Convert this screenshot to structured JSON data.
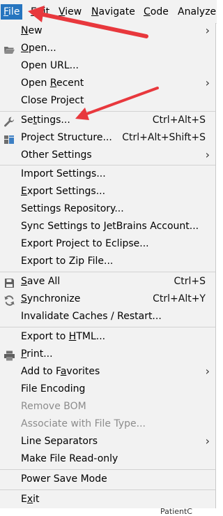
{
  "menubar": {
    "items": [
      {
        "pre": "",
        "mn": "F",
        "post": "ile"
      },
      {
        "pre": "",
        "mn": "E",
        "post": "dit"
      },
      {
        "pre": "",
        "mn": "V",
        "post": "iew"
      },
      {
        "pre": "",
        "mn": "N",
        "post": "avigate"
      },
      {
        "pre": "",
        "mn": "C",
        "post": "ode"
      },
      {
        "pre": "Analyze",
        "mn": "",
        "post": ""
      }
    ]
  },
  "menu": {
    "items": [
      {
        "pre": "",
        "mn": "N",
        "post": "ew",
        "shortcut": ""
      },
      {
        "pre": "",
        "mn": "O",
        "post": "pen...",
        "shortcut": ""
      },
      {
        "pre": "Open URL...",
        "mn": "",
        "post": "",
        "shortcut": ""
      },
      {
        "pre": "Open ",
        "mn": "R",
        "post": "ecent",
        "shortcut": ""
      },
      {
        "pre": "Close Project",
        "mn": "",
        "post": "",
        "shortcut": ""
      },
      {
        "pre": "Se",
        "mn": "t",
        "post": "tings...",
        "shortcut": "Ctrl+Alt+S"
      },
      {
        "pre": "Project Structure...",
        "mn": "",
        "post": "",
        "shortcut": "Ctrl+Alt+Shift+S"
      },
      {
        "pre": "Other Settings",
        "mn": "",
        "post": "",
        "shortcut": ""
      },
      {
        "pre": "Import Settings...",
        "mn": "",
        "post": "",
        "shortcut": ""
      },
      {
        "pre": "",
        "mn": "E",
        "post": "xport Settings...",
        "shortcut": ""
      },
      {
        "pre": "Settings Repository...",
        "mn": "",
        "post": "",
        "shortcut": ""
      },
      {
        "pre": "Sync Settings to JetBrains Account...",
        "mn": "",
        "post": "",
        "shortcut": ""
      },
      {
        "pre": "Export Project to Eclipse...",
        "mn": "",
        "post": "",
        "shortcut": ""
      },
      {
        "pre": "Export to Zip File...",
        "mn": "",
        "post": "",
        "shortcut": ""
      },
      {
        "pre": "",
        "mn": "S",
        "post": "ave All",
        "shortcut": "Ctrl+S"
      },
      {
        "pre": "",
        "mn": "S",
        "post": "ynchronize",
        "shortcut": "Ctrl+Alt+Y"
      },
      {
        "pre": "Invalidate Caches / Restart...",
        "mn": "",
        "post": "",
        "shortcut": ""
      },
      {
        "pre": "Export to ",
        "mn": "H",
        "post": "TML...",
        "shortcut": ""
      },
      {
        "pre": "",
        "mn": "P",
        "post": "rint...",
        "shortcut": ""
      },
      {
        "pre": "Add to F",
        "mn": "a",
        "post": "vorites",
        "shortcut": ""
      },
      {
        "pre": "File Encoding",
        "mn": "",
        "post": "",
        "shortcut": ""
      },
      {
        "pre": "Remove BOM",
        "mn": "",
        "post": "",
        "shortcut": ""
      },
      {
        "pre": "Associate with File Type...",
        "mn": "",
        "post": "",
        "shortcut": ""
      },
      {
        "pre": "Line Separators",
        "mn": "",
        "post": "",
        "shortcut": ""
      },
      {
        "pre": "Make File Read-only",
        "mn": "",
        "post": "",
        "shortcut": ""
      },
      {
        "pre": "Power Save Mode",
        "mn": "",
        "post": "",
        "shortcut": ""
      },
      {
        "pre": "E",
        "mn": "x",
        "post": "it",
        "shortcut": ""
      }
    ]
  },
  "background": {
    "fragment_label": "PatientC"
  },
  "colors": {
    "menu_bg": "#f2f2f2",
    "active_bg": "#2675bf",
    "arrow": "#e8383d",
    "disabled_text": "#8c8c8c"
  }
}
